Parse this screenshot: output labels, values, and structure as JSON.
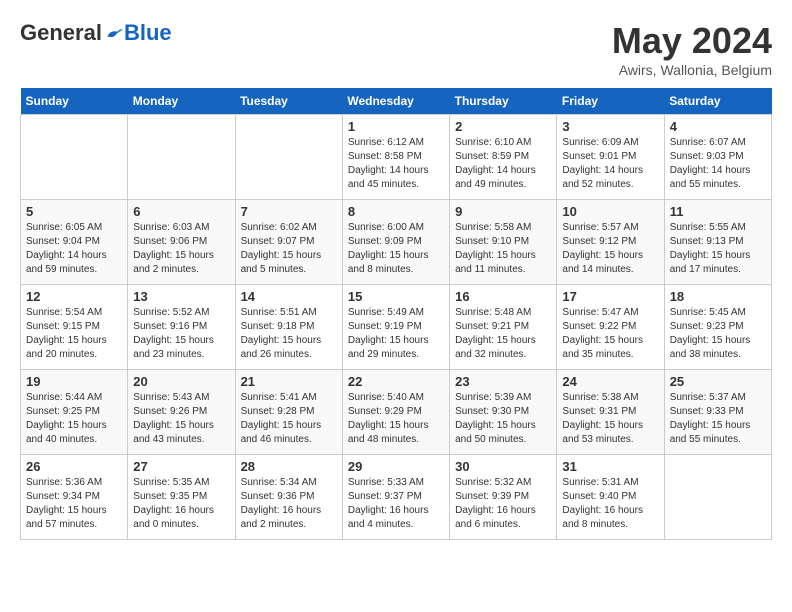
{
  "header": {
    "logo_general": "General",
    "logo_blue": "Blue",
    "month_title": "May 2024",
    "location": "Awirs, Wallonia, Belgium"
  },
  "weekdays": [
    "Sunday",
    "Monday",
    "Tuesday",
    "Wednesday",
    "Thursday",
    "Friday",
    "Saturday"
  ],
  "weeks": [
    [
      {
        "day": "",
        "sunrise": "",
        "sunset": "",
        "daylight": ""
      },
      {
        "day": "",
        "sunrise": "",
        "sunset": "",
        "daylight": ""
      },
      {
        "day": "",
        "sunrise": "",
        "sunset": "",
        "daylight": ""
      },
      {
        "day": "1",
        "sunrise": "Sunrise: 6:12 AM",
        "sunset": "Sunset: 8:58 PM",
        "daylight": "Daylight: 14 hours and 45 minutes."
      },
      {
        "day": "2",
        "sunrise": "Sunrise: 6:10 AM",
        "sunset": "Sunset: 8:59 PM",
        "daylight": "Daylight: 14 hours and 49 minutes."
      },
      {
        "day": "3",
        "sunrise": "Sunrise: 6:09 AM",
        "sunset": "Sunset: 9:01 PM",
        "daylight": "Daylight: 14 hours and 52 minutes."
      },
      {
        "day": "4",
        "sunrise": "Sunrise: 6:07 AM",
        "sunset": "Sunset: 9:03 PM",
        "daylight": "Daylight: 14 hours and 55 minutes."
      }
    ],
    [
      {
        "day": "5",
        "sunrise": "Sunrise: 6:05 AM",
        "sunset": "Sunset: 9:04 PM",
        "daylight": "Daylight: 14 hours and 59 minutes."
      },
      {
        "day": "6",
        "sunrise": "Sunrise: 6:03 AM",
        "sunset": "Sunset: 9:06 PM",
        "daylight": "Daylight: 15 hours and 2 minutes."
      },
      {
        "day": "7",
        "sunrise": "Sunrise: 6:02 AM",
        "sunset": "Sunset: 9:07 PM",
        "daylight": "Daylight: 15 hours and 5 minutes."
      },
      {
        "day": "8",
        "sunrise": "Sunrise: 6:00 AM",
        "sunset": "Sunset: 9:09 PM",
        "daylight": "Daylight: 15 hours and 8 minutes."
      },
      {
        "day": "9",
        "sunrise": "Sunrise: 5:58 AM",
        "sunset": "Sunset: 9:10 PM",
        "daylight": "Daylight: 15 hours and 11 minutes."
      },
      {
        "day": "10",
        "sunrise": "Sunrise: 5:57 AM",
        "sunset": "Sunset: 9:12 PM",
        "daylight": "Daylight: 15 hours and 14 minutes."
      },
      {
        "day": "11",
        "sunrise": "Sunrise: 5:55 AM",
        "sunset": "Sunset: 9:13 PM",
        "daylight": "Daylight: 15 hours and 17 minutes."
      }
    ],
    [
      {
        "day": "12",
        "sunrise": "Sunrise: 5:54 AM",
        "sunset": "Sunset: 9:15 PM",
        "daylight": "Daylight: 15 hours and 20 minutes."
      },
      {
        "day": "13",
        "sunrise": "Sunrise: 5:52 AM",
        "sunset": "Sunset: 9:16 PM",
        "daylight": "Daylight: 15 hours and 23 minutes."
      },
      {
        "day": "14",
        "sunrise": "Sunrise: 5:51 AM",
        "sunset": "Sunset: 9:18 PM",
        "daylight": "Daylight: 15 hours and 26 minutes."
      },
      {
        "day": "15",
        "sunrise": "Sunrise: 5:49 AM",
        "sunset": "Sunset: 9:19 PM",
        "daylight": "Daylight: 15 hours and 29 minutes."
      },
      {
        "day": "16",
        "sunrise": "Sunrise: 5:48 AM",
        "sunset": "Sunset: 9:21 PM",
        "daylight": "Daylight: 15 hours and 32 minutes."
      },
      {
        "day": "17",
        "sunrise": "Sunrise: 5:47 AM",
        "sunset": "Sunset: 9:22 PM",
        "daylight": "Daylight: 15 hours and 35 minutes."
      },
      {
        "day": "18",
        "sunrise": "Sunrise: 5:45 AM",
        "sunset": "Sunset: 9:23 PM",
        "daylight": "Daylight: 15 hours and 38 minutes."
      }
    ],
    [
      {
        "day": "19",
        "sunrise": "Sunrise: 5:44 AM",
        "sunset": "Sunset: 9:25 PM",
        "daylight": "Daylight: 15 hours and 40 minutes."
      },
      {
        "day": "20",
        "sunrise": "Sunrise: 5:43 AM",
        "sunset": "Sunset: 9:26 PM",
        "daylight": "Daylight: 15 hours and 43 minutes."
      },
      {
        "day": "21",
        "sunrise": "Sunrise: 5:41 AM",
        "sunset": "Sunset: 9:28 PM",
        "daylight": "Daylight: 15 hours and 46 minutes."
      },
      {
        "day": "22",
        "sunrise": "Sunrise: 5:40 AM",
        "sunset": "Sunset: 9:29 PM",
        "daylight": "Daylight: 15 hours and 48 minutes."
      },
      {
        "day": "23",
        "sunrise": "Sunrise: 5:39 AM",
        "sunset": "Sunset: 9:30 PM",
        "daylight": "Daylight: 15 hours and 50 minutes."
      },
      {
        "day": "24",
        "sunrise": "Sunrise: 5:38 AM",
        "sunset": "Sunset: 9:31 PM",
        "daylight": "Daylight: 15 hours and 53 minutes."
      },
      {
        "day": "25",
        "sunrise": "Sunrise: 5:37 AM",
        "sunset": "Sunset: 9:33 PM",
        "daylight": "Daylight: 15 hours and 55 minutes."
      }
    ],
    [
      {
        "day": "26",
        "sunrise": "Sunrise: 5:36 AM",
        "sunset": "Sunset: 9:34 PM",
        "daylight": "Daylight: 15 hours and 57 minutes."
      },
      {
        "day": "27",
        "sunrise": "Sunrise: 5:35 AM",
        "sunset": "Sunset: 9:35 PM",
        "daylight": "Daylight: 16 hours and 0 minutes."
      },
      {
        "day": "28",
        "sunrise": "Sunrise: 5:34 AM",
        "sunset": "Sunset: 9:36 PM",
        "daylight": "Daylight: 16 hours and 2 minutes."
      },
      {
        "day": "29",
        "sunrise": "Sunrise: 5:33 AM",
        "sunset": "Sunset: 9:37 PM",
        "daylight": "Daylight: 16 hours and 4 minutes."
      },
      {
        "day": "30",
        "sunrise": "Sunrise: 5:32 AM",
        "sunset": "Sunset: 9:39 PM",
        "daylight": "Daylight: 16 hours and 6 minutes."
      },
      {
        "day": "31",
        "sunrise": "Sunrise: 5:31 AM",
        "sunset": "Sunset: 9:40 PM",
        "daylight": "Daylight: 16 hours and 8 minutes."
      },
      {
        "day": "",
        "sunrise": "",
        "sunset": "",
        "daylight": ""
      }
    ]
  ]
}
